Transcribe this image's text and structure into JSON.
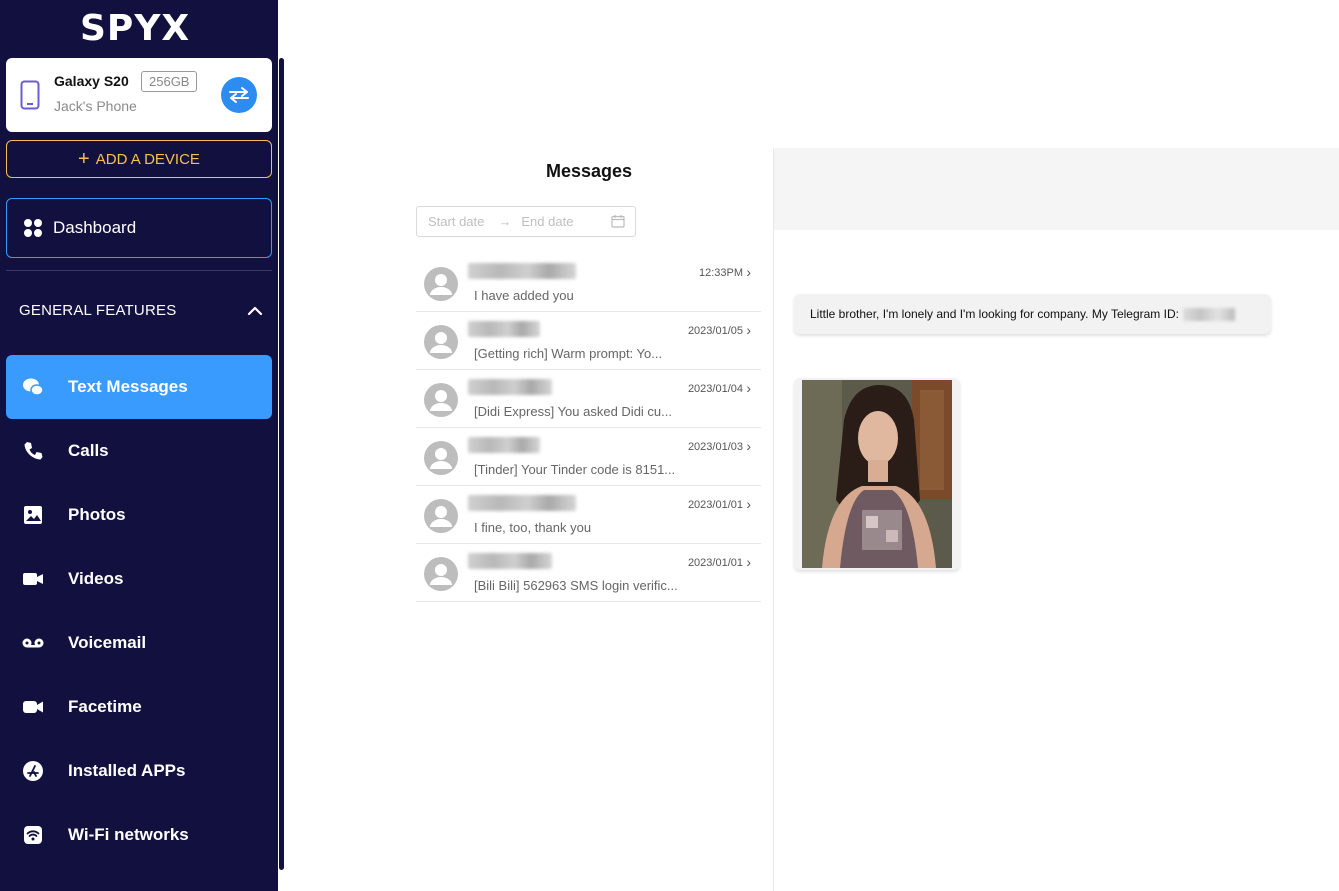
{
  "app": {
    "logo_text": "SPYX"
  },
  "device": {
    "name": "Galaxy S20",
    "storage": "256GB",
    "owner": "Jack's Phone"
  },
  "sidebar": {
    "add_device_label": "ADD A DEVICE",
    "dashboard_label": "Dashboard",
    "section_title": "GENERAL FEATURES",
    "items": [
      {
        "label": "Text Messages",
        "icon": "chat-bubbles-icon",
        "active": true
      },
      {
        "label": "Calls",
        "icon": "phone-icon"
      },
      {
        "label": "Photos",
        "icon": "image-icon"
      },
      {
        "label": "Videos",
        "icon": "video-camera-icon"
      },
      {
        "label": "Voicemail",
        "icon": "voicemail-icon"
      },
      {
        "label": "Facetime",
        "icon": "facetime-icon"
      },
      {
        "label": "Installed APPs",
        "icon": "app-store-icon"
      },
      {
        "label": "Wi-Fi networks",
        "icon": "wifi-icon"
      }
    ]
  },
  "messages": {
    "title": "Messages",
    "date_range": {
      "start_placeholder": "Start date",
      "end_placeholder": "End date"
    },
    "conversations": [
      {
        "time": "12:33PM",
        "preview": "I have added you"
      },
      {
        "time": "2023/01/05",
        "preview": "[Getting rich] Warm prompt: Yo..."
      },
      {
        "time": "2023/01/04",
        "preview": "[Didi Express] You asked Didi cu..."
      },
      {
        "time": "2023/01/03",
        "preview": "[Tinder] Your Tinder code is 8151..."
      },
      {
        "time": "2023/01/01",
        "preview": "I fine, too, thank you"
      },
      {
        "time": "2023/01/01",
        "preview": "[Bili Bili] 562963 SMS login verific..."
      }
    ]
  },
  "chat": {
    "message_text": "Little brother, I'm lonely and I'm looking for company. My Telegram ID:"
  },
  "colors": {
    "sidebar_bg": "#12103f",
    "accent_blue": "#3a9bff",
    "add_device_yellow": "#f5c04e"
  }
}
